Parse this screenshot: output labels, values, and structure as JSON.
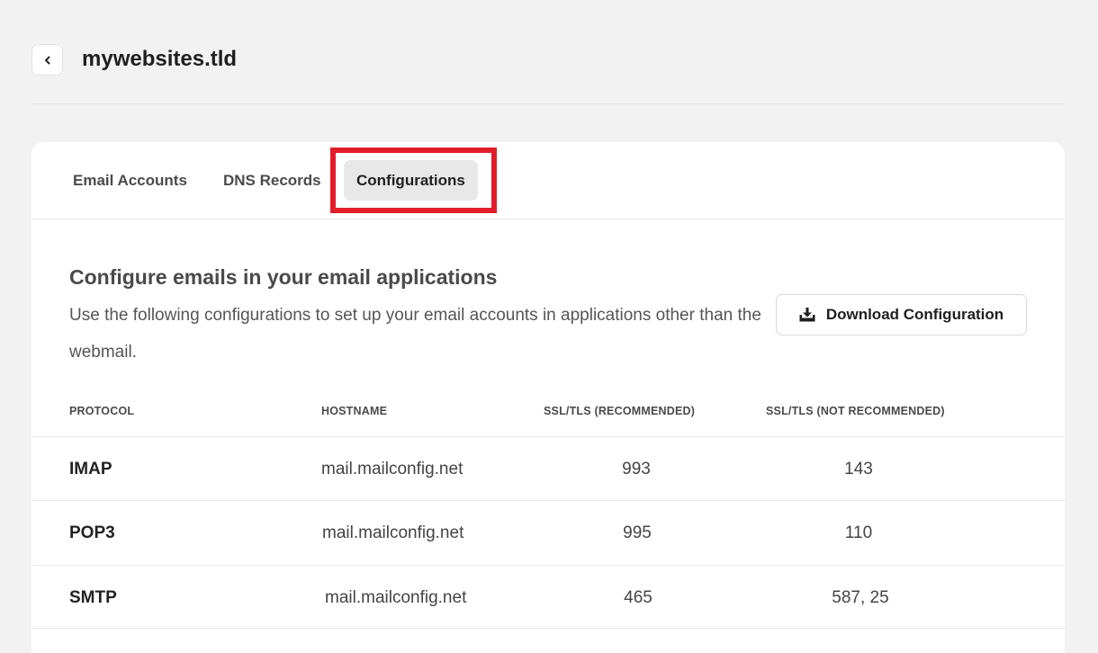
{
  "header": {
    "title": "mywebsites.tld"
  },
  "tabs": [
    {
      "label": "Email Accounts"
    },
    {
      "label": "DNS Records"
    },
    {
      "label": "Configurations",
      "active": true
    }
  ],
  "section": {
    "title": "Configure emails in your email applications",
    "description": "Use the following configurations to set up your email accounts in applications other than the webmail.",
    "download_label": "Download Configuration"
  },
  "table": {
    "columns": [
      "PROTOCOL",
      "HOSTNAME",
      "SSL/TLS (RECOMMENDED)",
      "SSL/TLS (NOT RECOMMENDED)"
    ],
    "rows": [
      {
        "protocol": "IMAP",
        "hostname": "mail.mailconfig.net",
        "ssl": "993",
        "no_ssl": "143"
      },
      {
        "protocol": "POP3",
        "hostname": "mail.mailconfig.net",
        "ssl": "995",
        "no_ssl": "110"
      },
      {
        "protocol": "SMTP",
        "hostname": "mail.mailconfig.net",
        "ssl": "465",
        "no_ssl": "587, 25"
      }
    ]
  },
  "icons": {
    "back": "chevron-left-icon",
    "download": "download-tray-icon"
  },
  "colors": {
    "highlight": "#e21d2a",
    "active_tab_bg": "#e8e8e8",
    "page_bg": "#f2f2f2"
  }
}
